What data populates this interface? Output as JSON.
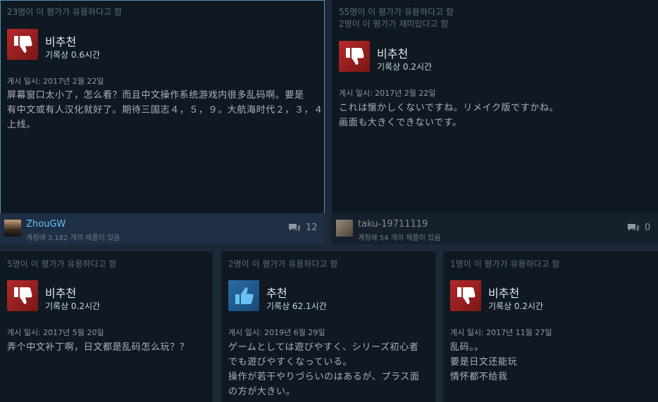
{
  "reviews": [
    {
      "helpful": "23명이 이 평가가 유용하다고 함",
      "funny": "",
      "verdict": "비추천",
      "hours": "기록상 0.6시간",
      "posted": "게시 일시: 2017년 2월 22일",
      "body_lines": [
        "屏幕窗口太小了，怎么看？而且中文操作系统游戏内很多乱码啊。要是",
        "有中文或有人汉化就好了。期待三国志４，５，９。大航海时代２，３，４",
        "上线。"
      ],
      "author": "ZhouGW",
      "products": "계정에 3,182 개의 제품이 있음",
      "comments": "12",
      "thumb_icon": "thumbs-down-icon"
    },
    {
      "helpful": "55명이 이 평가가 유용하다고 함",
      "funny": "2명이 이 평가가 재미있다고 함",
      "verdict": "비추천",
      "hours": "기록상 0.2시간",
      "posted": "게시 일시: 2017년 2월 22일",
      "body_lines": [
        "これは懐かしくないですね。リメイク版ですかね。",
        "画面も大きくできないです。"
      ],
      "author": "taku-19711119",
      "products": "계정에 54 개의 제품이 있음",
      "comments": "0",
      "thumb_icon": "thumbs-down-icon"
    },
    {
      "helpful": "5명이 이 평가가 유용하다고 함",
      "verdict": "비추천",
      "hours": "기록상 0.2시간",
      "posted": "게시 일시: 2017년 5월 20일",
      "body_lines": [
        "弄个中文补丁啊，日文都是乱码怎么玩？？"
      ],
      "thumb_icon": "thumbs-down-icon"
    },
    {
      "helpful": "2명이 이 평가가 유용하다고 함",
      "verdict": "추천",
      "hours": "기록상 62.1시간",
      "posted": "게시 일시: 2019년 6월 29일",
      "body_lines": [
        "ゲームとしては遊びやすく、シリーズ初心者",
        "でも遊びやすくなっている。",
        "操作が若干やりづらいのはあるが、プラス面",
        "の方が大きい。"
      ],
      "thumb_icon": "thumbs-up-icon"
    },
    {
      "helpful": "1명이 이 평가가 유용하다고 함",
      "verdict": "비추천",
      "hours": "기록상 0.2시간",
      "posted": "게시 일시: 2017년 11월 27일",
      "body_lines": [
        "乱码。。",
        "要是日文还能玩",
        "情怀都不给我"
      ],
      "thumb_icon": "thumbs-down-icon"
    }
  ]
}
